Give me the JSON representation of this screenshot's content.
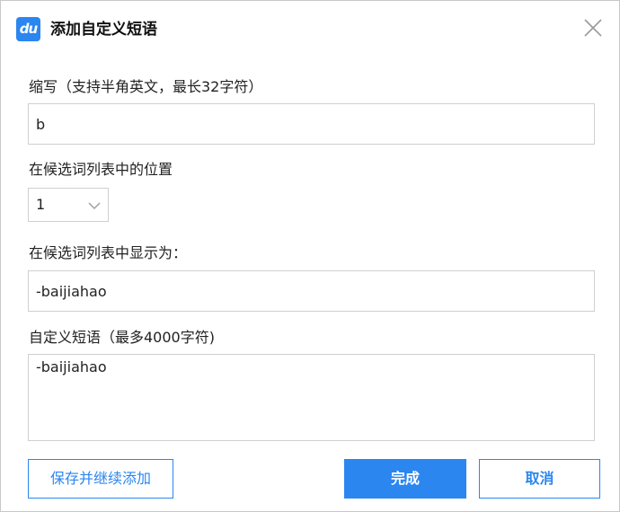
{
  "dialog": {
    "logo_text": "du",
    "title": "添加自定义短语"
  },
  "fields": {
    "abbreviation": {
      "label": "缩写（支持半角英文，最长32字符）",
      "value": "b"
    },
    "position": {
      "label": "在候选词列表中的位置",
      "selected": "1"
    },
    "display_as": {
      "label": "在候选词列表中显示为：",
      "value": "-baijiahao"
    },
    "phrase": {
      "label": "自定义短语（最多4000字符)",
      "value": "-baijiahao"
    }
  },
  "buttons": {
    "save_continue": "保存并继续添加",
    "done": "完成",
    "cancel": "取消"
  },
  "colors": {
    "accent": "#2b86f0",
    "border": "#cfcfcf"
  },
  "icons": {
    "close": "close-icon",
    "dropdown": "chevron-down-icon"
  }
}
